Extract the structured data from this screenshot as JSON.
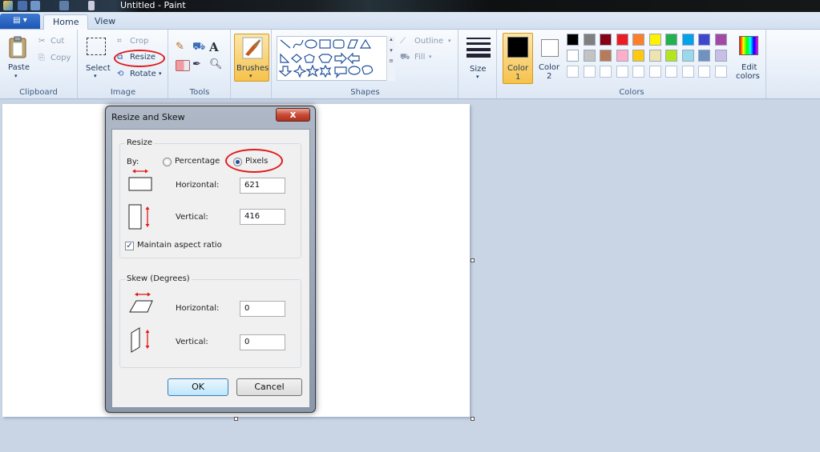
{
  "window": {
    "title": "Untitled - Paint"
  },
  "tabs": [
    {
      "label": "Home"
    },
    {
      "label": "View"
    }
  ],
  "ribbon": {
    "clipboard": {
      "paste": "Paste",
      "cut": "Cut",
      "copy": "Copy",
      "group": "Clipboard"
    },
    "image": {
      "select": "Select",
      "crop": "Crop",
      "resize": "Resize",
      "rotate": "Rotate",
      "group": "Image"
    },
    "tools": {
      "group": "Tools",
      "text_tool": "A"
    },
    "brushes": {
      "label": "Brushes"
    },
    "shapes": {
      "outline": "Outline",
      "fill": "Fill",
      "group": "Shapes"
    },
    "size": {
      "label": "Size"
    },
    "colors": {
      "color1": "Color",
      "color1_num": "1",
      "color2": "Color",
      "color2_num": "2",
      "edit1": "Edit",
      "edit2": "colors",
      "group": "Colors",
      "color1_value": "#000000",
      "color2_value": "#ffffff",
      "palette_row1": [
        "#000000",
        "#7f7f7f",
        "#880015",
        "#ed1c24",
        "#ff7f27",
        "#fff200",
        "#22b14c",
        "#00a2e8",
        "#3f48cc",
        "#a349a4"
      ],
      "palette_row2": [
        "#ffffff",
        "#c3c3c3",
        "#b97a57",
        "#ffaec9",
        "#ffc90e",
        "#efe4b0",
        "#b5e61d",
        "#99d9ea",
        "#7092be",
        "#c8bfe7"
      ]
    }
  },
  "dialog": {
    "title": "Resize and Skew",
    "close": "x",
    "resize": {
      "legend": "Resize",
      "by_label": "By:",
      "percentage": "Percentage",
      "pixels": "Pixels",
      "horizontal_label": "Horizontal:",
      "horizontal_value": "621",
      "vertical_label": "Vertical:",
      "vertical_value": "416",
      "maintain": "Maintain aspect ratio"
    },
    "skew": {
      "legend": "Skew (Degrees)",
      "horizontal_label": "Horizontal:",
      "horizontal_value": "0",
      "vertical_label": "Vertical:",
      "vertical_value": "0"
    },
    "ok": "OK",
    "cancel": "Cancel"
  }
}
